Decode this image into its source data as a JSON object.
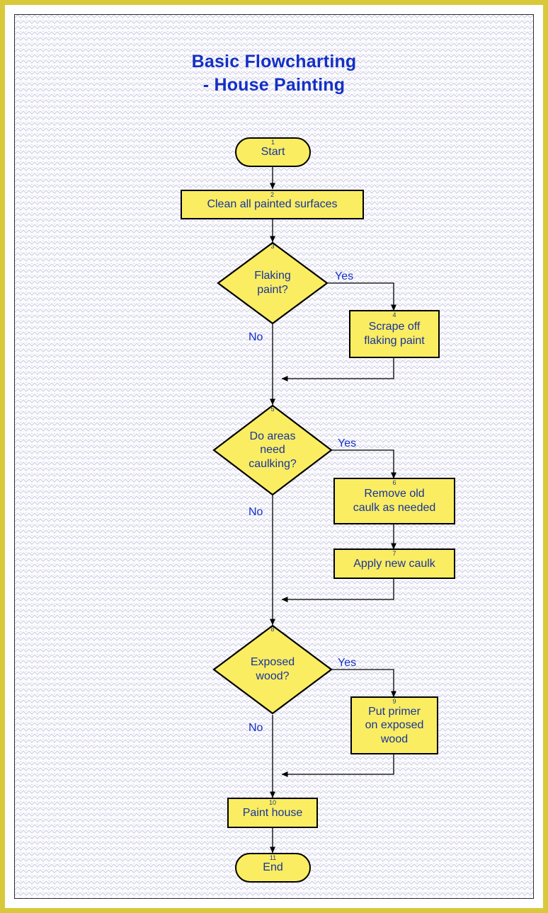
{
  "document": {
    "title_line1": "Basic Flowcharting",
    "title_line2": "- House Painting",
    "title": "Basic Flowcharting\n- House Painting"
  },
  "theme": {
    "outer_border_color": "#d9c93a",
    "inner_border_color": "#2b2b3a",
    "node_fill": "#faed62",
    "node_border": "#000000",
    "text_color": "#18349c",
    "title_color": "#1430c4",
    "label_color": "#1430c4",
    "background": "#fbfbfe"
  },
  "chart_data": {
    "type": "diagram",
    "diagram_type": "flowchart",
    "title": "Basic Flowcharting - House Painting",
    "orientation": "top-to-bottom",
    "nodes": [
      {
        "id": "1",
        "number": "1",
        "shape": "terminator",
        "label": "Start"
      },
      {
        "id": "2",
        "number": "2",
        "shape": "process",
        "label": "Clean all painted surfaces"
      },
      {
        "id": "3",
        "number": "3",
        "shape": "decision",
        "label": "Flaking\npaint?"
      },
      {
        "id": "4",
        "number": "4",
        "shape": "process",
        "label": "Scrape off\nflaking paint"
      },
      {
        "id": "5",
        "number": "5",
        "shape": "decision",
        "label": "Do areas\nneed\ncaulking?"
      },
      {
        "id": "6",
        "number": "6",
        "shape": "process",
        "label": "Remove old\ncaulk as needed"
      },
      {
        "id": "7",
        "number": "7",
        "shape": "process",
        "label": "Apply new caulk"
      },
      {
        "id": "8",
        "number": "8",
        "shape": "decision",
        "label": "Exposed\nwood?"
      },
      {
        "id": "9",
        "number": "9",
        "shape": "process",
        "label": "Put primer\non exposed\nwood"
      },
      {
        "id": "10",
        "number": "10",
        "shape": "process",
        "label": "Paint house"
      },
      {
        "id": "11",
        "number": "11",
        "shape": "terminator",
        "label": "End"
      }
    ],
    "edges": [
      {
        "from": "1",
        "to": "2",
        "label": ""
      },
      {
        "from": "2",
        "to": "3",
        "label": ""
      },
      {
        "from": "3",
        "to": "4",
        "label": "Yes"
      },
      {
        "from": "3",
        "to": "5",
        "label": "No"
      },
      {
        "from": "4",
        "to": "5",
        "label": ""
      },
      {
        "from": "5",
        "to": "6",
        "label": "Yes"
      },
      {
        "from": "5",
        "to": "8",
        "label": "No"
      },
      {
        "from": "6",
        "to": "7",
        "label": ""
      },
      {
        "from": "7",
        "to": "8",
        "label": ""
      },
      {
        "from": "8",
        "to": "9",
        "label": "Yes"
      },
      {
        "from": "8",
        "to": "10",
        "label": "No"
      },
      {
        "from": "9",
        "to": "10",
        "label": ""
      },
      {
        "from": "10",
        "to": "11",
        "label": ""
      }
    ],
    "edge_labels": {
      "yes1": "Yes",
      "no1": "No",
      "yes2": "Yes",
      "no2": "No",
      "yes3": "Yes",
      "no3": "No"
    }
  }
}
